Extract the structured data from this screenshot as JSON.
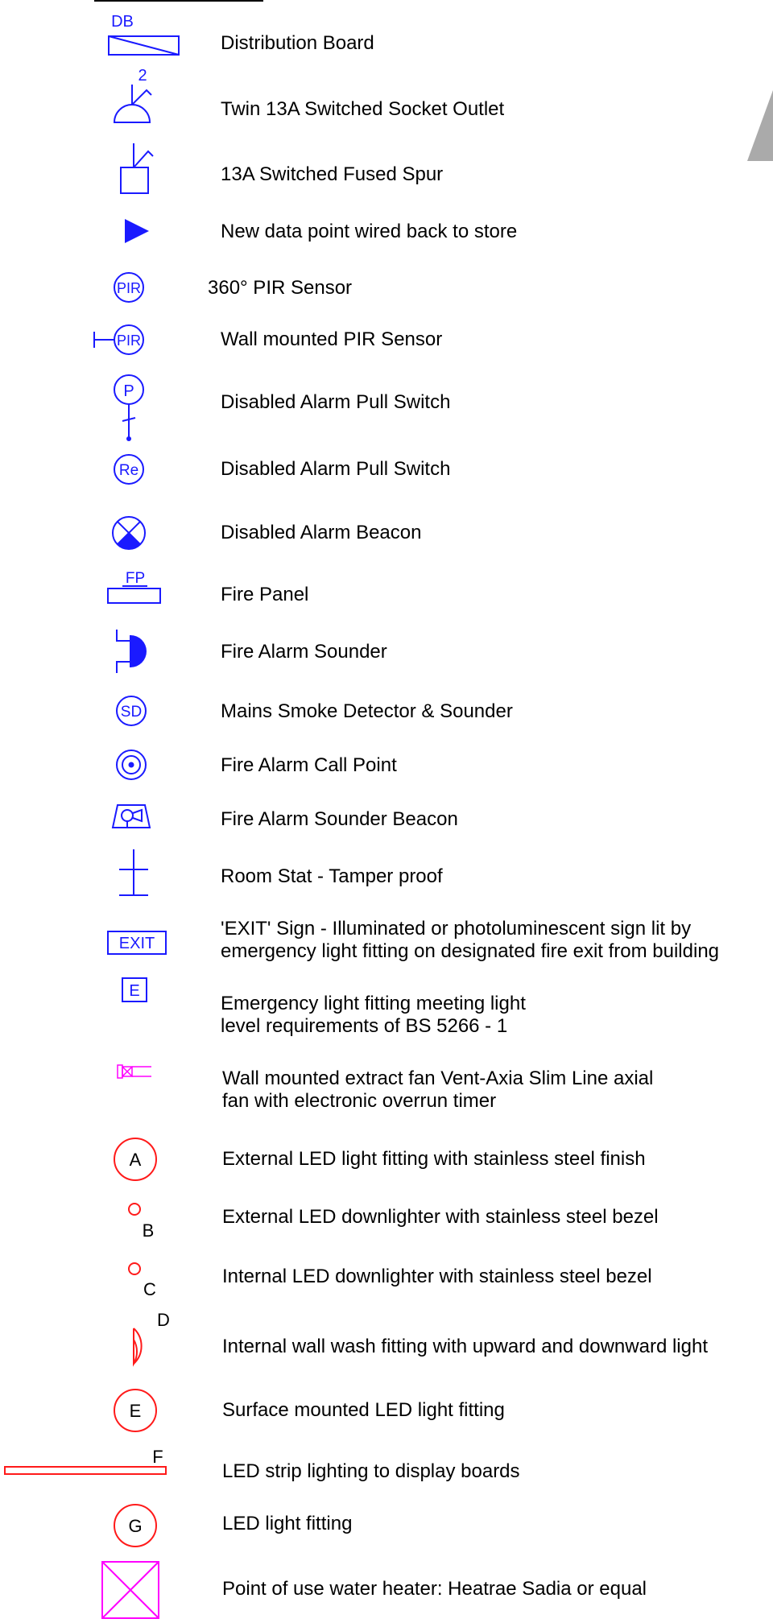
{
  "symbol_text": {
    "db": "DB",
    "socket_count": "2",
    "pir": "PIR",
    "pull": "P",
    "re": "Re",
    "fp": "FP",
    "sd": "SD",
    "exit": "EXIT",
    "e_box": "E",
    "a": "A",
    "b": "B",
    "c": "C",
    "d": "D",
    "e": "E",
    "f": "F",
    "g": "G"
  },
  "colors": {
    "blue": "#1a1aff",
    "red": "#ff1a1a",
    "magenta": "#ff00ff",
    "gray": "#aaaaaa"
  },
  "legend": [
    {
      "key": "distribution_board",
      "label": "Distribution Board"
    },
    {
      "key": "twin_socket",
      "label": "Twin 13A Switched Socket Outlet"
    },
    {
      "key": "fused_spur",
      "label": "13A Switched Fused Spur"
    },
    {
      "key": "data_point",
      "label": "New data point wired back to store"
    },
    {
      "key": "pir_360",
      "label": "360° PIR Sensor"
    },
    {
      "key": "pir_wall",
      "label": "Wall mounted PIR Sensor"
    },
    {
      "key": "pull_switch",
      "label": "Disabled Alarm Pull Switch"
    },
    {
      "key": "reset_switch",
      "label": "Disabled Alarm Pull Switch"
    },
    {
      "key": "alarm_beacon",
      "label": "Disabled Alarm Beacon"
    },
    {
      "key": "fire_panel",
      "label": "Fire Panel"
    },
    {
      "key": "alarm_sounder",
      "label": "Fire Alarm Sounder"
    },
    {
      "key": "smoke_detector",
      "label": "Mains Smoke Detector & Sounder"
    },
    {
      "key": "call_point",
      "label": "Fire Alarm Call Point"
    },
    {
      "key": "sounder_beacon",
      "label": "Fire Alarm Sounder Beacon"
    },
    {
      "key": "room_stat",
      "label": "Room Stat - Tamper proof"
    },
    {
      "key": "exit_sign",
      "label": [
        "'EXIT' Sign - Illuminated or photoluminescent sign lit by",
        "emergency light fitting on designated fire exit from building"
      ]
    },
    {
      "key": "emergency_light",
      "label": [
        "Emergency light fitting meeting light",
        "level requirements of BS 5266 - 1"
      ]
    },
    {
      "key": "extract_fan",
      "label": [
        "Wall mounted extract fan Vent-Axia Slim Line axial",
        "fan with electronic overrun timer"
      ]
    },
    {
      "key": "led_a",
      "label": "External LED light fitting with stainless steel finish"
    },
    {
      "key": "led_b",
      "label": "External LED downlighter with stainless steel bezel"
    },
    {
      "key": "led_c",
      "label": "Internal LED downlighter with stainless steel bezel"
    },
    {
      "key": "wall_wash_d",
      "label": "Internal wall wash fitting with upward and downward light"
    },
    {
      "key": "led_e",
      "label": "Surface mounted LED light fitting"
    },
    {
      "key": "strip_f",
      "label": "LED strip lighting to display boards"
    },
    {
      "key": "led_g",
      "label": "LED light fitting"
    },
    {
      "key": "water_heater",
      "label": "Point of use water heater: Heatrae Sadia or equal"
    }
  ]
}
